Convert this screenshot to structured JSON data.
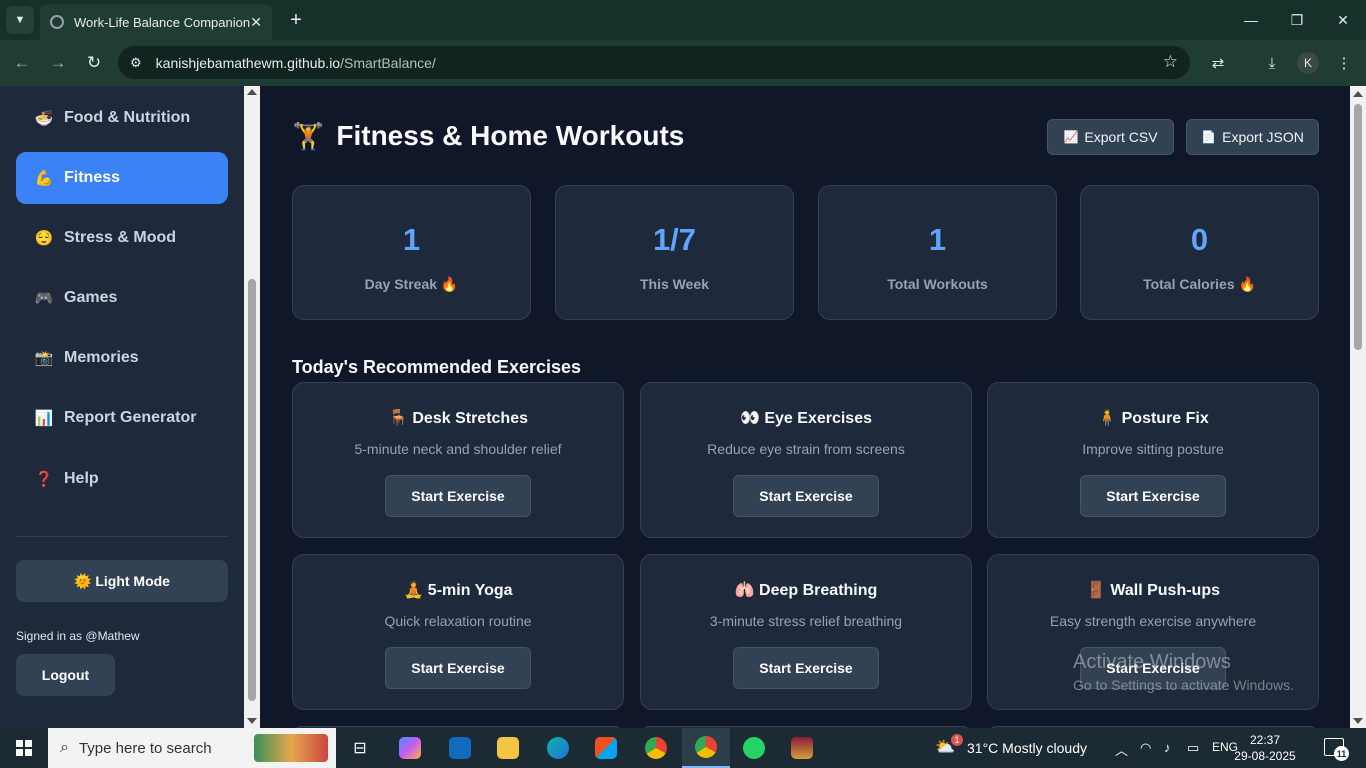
{
  "browser": {
    "tab_title": "Work-Life Balance Companion",
    "url_host": "kanishjebamathewm.github.io",
    "url_path": "/SmartBalance/",
    "profile_initial": "K"
  },
  "sidebar": {
    "items": [
      {
        "emoji": "🍜",
        "label": "Food & Nutrition"
      },
      {
        "emoji": "💪",
        "label": "Fitness"
      },
      {
        "emoji": "😌",
        "label": "Stress & Mood"
      },
      {
        "emoji": "🎮",
        "label": "Games"
      },
      {
        "emoji": "📸",
        "label": "Memories"
      },
      {
        "emoji": "📊",
        "label": "Report Generator"
      },
      {
        "emoji": "❓",
        "label": "Help"
      }
    ],
    "active_index": 1,
    "light_mode_label": "🌞 Light Mode",
    "signed_in_text": "Signed in as @Mathew",
    "logout_label": "Logout"
  },
  "main": {
    "title_emoji": "🏋️",
    "title": "Fitness & Home Workouts",
    "export_csv": {
      "emoji": "📈",
      "label": "Export CSV"
    },
    "export_json": {
      "emoji": "📄",
      "label": "Export JSON"
    },
    "stats": [
      {
        "value": "1",
        "label": "Day Streak 🔥"
      },
      {
        "value": "1/7",
        "label": "This Week"
      },
      {
        "value": "1",
        "label": "Total Workouts"
      },
      {
        "value": "0",
        "label": "Total Calories 🔥"
      }
    ],
    "section_title": "Today's Recommended Exercises",
    "exercises": [
      {
        "title": "🪑 Desk Stretches",
        "desc": "5-minute neck and shoulder relief",
        "button": "Start Exercise"
      },
      {
        "title": "👀 Eye Exercises",
        "desc": "Reduce eye strain from screens",
        "button": "Start Exercise"
      },
      {
        "title": "🧍 Posture Fix",
        "desc": "Improve sitting posture",
        "button": "Start Exercise"
      },
      {
        "title": "🧘 5-min Yoga",
        "desc": "Quick relaxation routine",
        "button": "Start Exercise"
      },
      {
        "title": "🫁 Deep Breathing",
        "desc": "3-minute stress relief breathing",
        "button": "Start Exercise"
      },
      {
        "title": "🚪 Wall Push-ups",
        "desc": "Easy strength exercise anywhere",
        "button": "Start Exercise"
      }
    ]
  },
  "watermark": {
    "line1": "Activate Windows",
    "line2": "Go to Settings to activate Windows."
  },
  "taskbar": {
    "search_placeholder": "Type here to search",
    "weather": "31°C  Mostly cloudy",
    "weather_badge": "1",
    "language": "ENG",
    "time": "22:37",
    "date": "29-08-2025",
    "notification_count": "11"
  },
  "colors": {
    "accent": "#3b82f6",
    "stat_value": "#60a5fa",
    "card_bg": "#1e293b",
    "page_bg": "#0f1729"
  }
}
